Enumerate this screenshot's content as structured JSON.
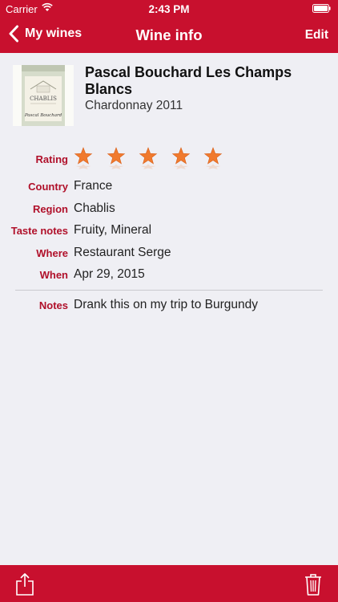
{
  "status": {
    "carrier": "Carrier",
    "time": "2:43 PM"
  },
  "nav": {
    "back_label": "My wines",
    "title": "Wine info",
    "edit_label": "Edit"
  },
  "wine": {
    "name": "Pascal Bouchard Les Champs Blancs",
    "variety_year": "Chardonnay 2011",
    "label_text": "CHABLIS",
    "label_maker": "Pascal Bouchard"
  },
  "details": {
    "rating_label": "Rating",
    "rating_value": 5,
    "rating_max": 5,
    "country_label": "Country",
    "country": "France",
    "region_label": "Region",
    "region": "Chablis",
    "taste_label": "Taste notes",
    "taste": "Fruity, Mineral",
    "where_label": "Where",
    "where": "Restaurant Serge",
    "when_label": "When",
    "when": "Apr 29, 2015",
    "notes_label": "Notes",
    "notes": "Drank this on my trip to Burgundy"
  },
  "toolbar": {
    "share_icon": "share-icon",
    "trash_icon": "trash-icon"
  },
  "colors": {
    "brand": "#c8102e",
    "label_red": "#b0102a",
    "background": "#efeff4",
    "star": "#f07a2e"
  }
}
